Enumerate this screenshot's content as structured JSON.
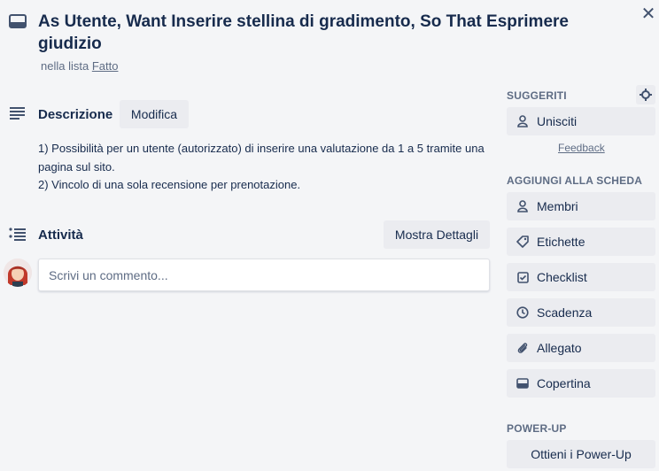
{
  "card": {
    "title": "As Utente, Want Inserire stellina di gradimento, So That Esprimere giudizio",
    "list_prefix": "nella lista",
    "list_name": "Fatto"
  },
  "description": {
    "heading": "Descrizione",
    "edit_label": "Modifica",
    "lines": [
      "1) Possibilità per un utente (autorizzato) di inserire una valutazione da 1 a 5 tramite una pagina sul sito.",
      "2) Vincolo di una sola recensione per prenotazione."
    ]
  },
  "activity": {
    "heading": "Attività",
    "details_label": "Mostra Dettagli",
    "comment_placeholder": "Scrivi un commento..."
  },
  "sidebar": {
    "suggested": {
      "heading": "SUGGERITI",
      "join_label": "Unisciti",
      "feedback_label": "Feedback"
    },
    "add": {
      "heading": "AGGIUNGI ALLA SCHEDA",
      "items": [
        {
          "label": "Membri",
          "icon": "person-icon"
        },
        {
          "label": "Etichette",
          "icon": "tag-icon"
        },
        {
          "label": "Checklist",
          "icon": "checklist-icon"
        },
        {
          "label": "Scadenza",
          "icon": "clock-icon"
        },
        {
          "label": "Allegato",
          "icon": "paperclip-icon"
        },
        {
          "label": "Copertina",
          "icon": "cover-icon"
        }
      ]
    },
    "powerup": {
      "heading": "POWER-UP",
      "button_label": "Ottieni i Power-Up"
    }
  },
  "colors": {
    "background": "#f4f5f7",
    "button": "#ebecf0",
    "text": "#172b4d",
    "muted": "#5e6c84"
  }
}
